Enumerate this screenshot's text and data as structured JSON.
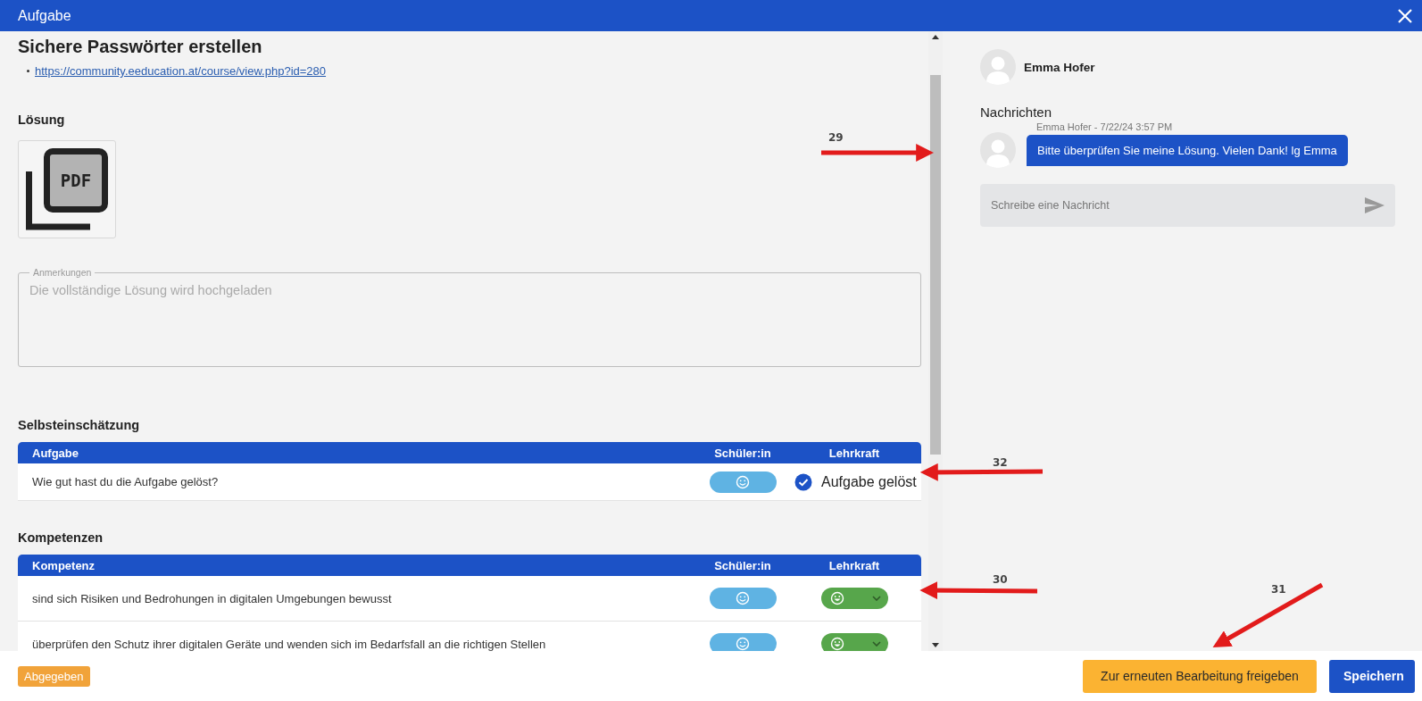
{
  "window": {
    "title": "Aufgabe"
  },
  "task": {
    "title": "Sichere Passwörter erstellen",
    "links": [
      "https://community.eeducation.at/course/view.php?id=280"
    ]
  },
  "solution": {
    "heading": "Lösung",
    "file_type": "PDF"
  },
  "notes": {
    "label": "Anmerkungen",
    "value": "Die vollständige Lösung wird hochgeladen"
  },
  "self_assessment": {
    "heading": "Selbsteinschätzung",
    "columns": [
      "Aufgabe",
      "Schüler:in",
      "Lehrkraft"
    ],
    "rows": [
      {
        "label": "Wie gut hast du die Aufgabe gelöst?",
        "teacher": {
          "kind": "check",
          "checked": true,
          "label": "Aufgabe gelöst"
        }
      }
    ]
  },
  "competences": {
    "heading": "Kompetenzen",
    "columns": [
      "Kompetenz",
      "Schüler:in",
      "Lehrkraft"
    ],
    "rows": [
      {
        "label": "sind sich Risiken und Bedrohungen in digitalen Umgebungen bewusst",
        "teacher": {
          "kind": "select"
        }
      },
      {
        "label": "überprüfen den Schutz ihrer digitalen Geräte und wenden sich im Bedarfsfall an die richtigen Stellen",
        "teacher": {
          "kind": "select"
        }
      }
    ]
  },
  "chat": {
    "user": {
      "name": "Emma Hofer"
    },
    "heading": "Nachrichten",
    "messages": [
      {
        "meta": "Emma Hofer - 7/22/24 3:57 PM",
        "text": "Bitte überprüfen Sie meine Lösung. Vielen Dank! lg Emma"
      }
    ],
    "composer": {
      "placeholder": "Schreibe eine Nachricht"
    }
  },
  "footer": {
    "status": "Abgegeben",
    "buttons": [
      {
        "label": "Zur erneuten Bearbeitung freigeben",
        "kind": "warning"
      },
      {
        "label": "Speichern",
        "kind": "primary"
      }
    ]
  },
  "annotations": [
    {
      "label": "29"
    },
    {
      "label": "32"
    },
    {
      "label": "30"
    },
    {
      "label": "31"
    }
  ]
}
